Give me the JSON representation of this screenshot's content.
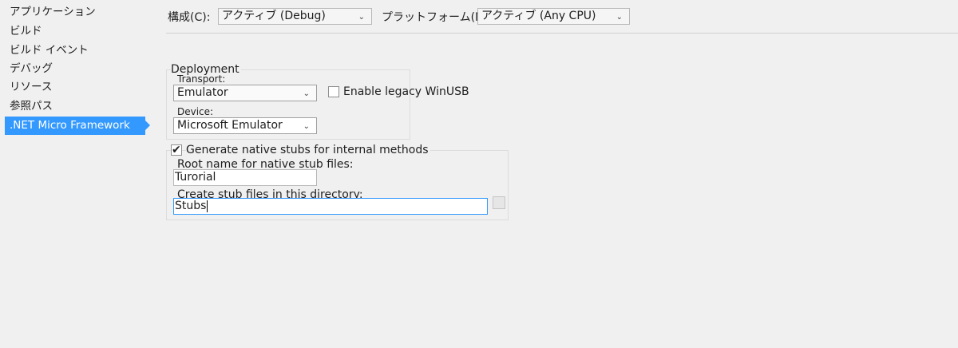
{
  "sidebar": {
    "items": [
      {
        "label": "アプリケーション"
      },
      {
        "label": "ビルド"
      },
      {
        "label": "ビルド イベント"
      },
      {
        "label": "デバッグ"
      },
      {
        "label": "リソース"
      },
      {
        "label": "参照パス"
      },
      {
        "label": ".NET Micro Framework",
        "selected": true
      }
    ]
  },
  "toolbar": {
    "configuration_label": "構成(C):",
    "configuration_value": "アクティブ (Debug)",
    "platform_label": "プラットフォーム(M):",
    "platform_value": "アクティブ (Any CPU)"
  },
  "deployment": {
    "group_title": "Deployment",
    "transport_label": "Transport:",
    "transport_value": "Emulator",
    "legacy_winusb_label": "Enable legacy WinUSB",
    "legacy_winusb_checked": false,
    "device_label": "Device:",
    "device_value": "Microsoft Emulator"
  },
  "stubs": {
    "generate_label": "Generate native stubs for internal methods",
    "generate_checked": true,
    "root_name_label": "Root name for native stub files:",
    "root_name_value": "Turorial",
    "directory_label": "Create stub files in this directory:",
    "directory_value": "Stubs"
  },
  "icons": {
    "dropdown": "chevron-down-icon",
    "check": "checkmark-icon"
  },
  "colors": {
    "selection": "#3399ff",
    "background": "#f0f0f0"
  }
}
